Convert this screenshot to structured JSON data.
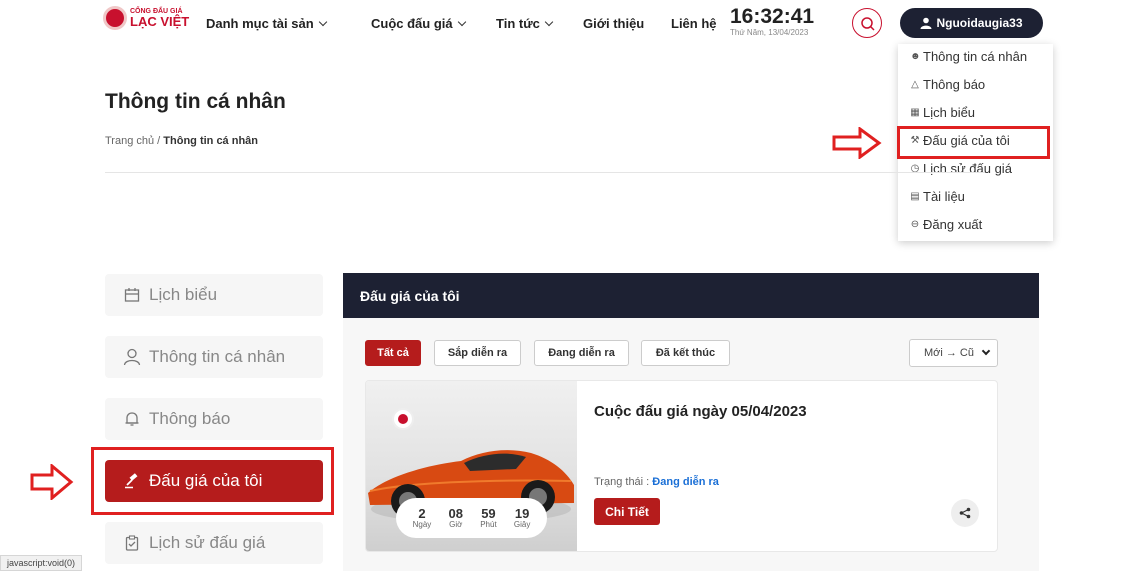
{
  "header": {
    "logo": {
      "top": "CỔNG ĐẤU GIÁ",
      "main": "LẠC VIỆT"
    },
    "nav": [
      {
        "label": "Danh mục tài sản"
      },
      {
        "label": "Cuộc đấu giá"
      },
      {
        "label": "Tin tức"
      },
      {
        "label": "Giới thiệu"
      },
      {
        "label": "Liên hệ"
      }
    ],
    "clock": {
      "time": "16:32:41",
      "date": "Thứ Năm, 13/04/2023"
    },
    "user": {
      "name": "Nguoidaugia33"
    }
  },
  "dropdown": {
    "items": [
      {
        "label": "Thông tin cá nhân",
        "icon": "user-icon"
      },
      {
        "label": "Thông báo",
        "icon": "bell-icon"
      },
      {
        "label": "Lịch biểu",
        "icon": "calendar-icon"
      },
      {
        "label": "Đấu giá của tôi",
        "icon": "gavel-icon"
      },
      {
        "label": "Lịch sử đấu giá",
        "icon": "history-icon"
      },
      {
        "label": "Tài liệu",
        "icon": "document-icon"
      },
      {
        "label": "Đăng xuất",
        "icon": "logout-icon"
      }
    ]
  },
  "page": {
    "title": "Thông tin cá nhân",
    "breadcrumb": {
      "home": "Trang chủ",
      "separator": " / ",
      "current": "Thông tin cá nhân"
    }
  },
  "sidebar": {
    "items": [
      {
        "label": "Lịch biểu",
        "icon": "calendar-icon"
      },
      {
        "label": "Thông tin cá nhân",
        "icon": "user-icon"
      },
      {
        "label": "Thông báo",
        "icon": "bell-icon"
      },
      {
        "label": "Đấu giá của tôi",
        "icon": "gavel-icon",
        "active": true
      },
      {
        "label": "Lịch sử đấu giá",
        "icon": "clipboard-check-icon"
      }
    ]
  },
  "main": {
    "title": "Đấu giá của tôi",
    "filters": [
      {
        "label": "Tất cả",
        "active": true
      },
      {
        "label": "Sắp diễn ra"
      },
      {
        "label": "Đang diễn ra"
      },
      {
        "label": "Đã kết thúc"
      }
    ],
    "sort": {
      "selected": "Mới → Cũ"
    },
    "card": {
      "title": "Cuộc đấu giá ngày 05/04/2023",
      "status_label": "Trạng thái : ",
      "status_value": "Đang diễn ra",
      "detail_label": "Chi Tiết",
      "countdown": [
        {
          "value": "2",
          "unit": "Ngày"
        },
        {
          "value": "08",
          "unit": "Giờ"
        },
        {
          "value": "59",
          "unit": "Phút"
        },
        {
          "value": "19",
          "unit": "Giây"
        }
      ]
    }
  },
  "statusbar": {
    "text": "javascript:void(0)"
  },
  "colors": {
    "accent": "#b51c1c",
    "dark": "#1d2133",
    "link": "#1a6fd6",
    "highlight": "#e02020"
  }
}
